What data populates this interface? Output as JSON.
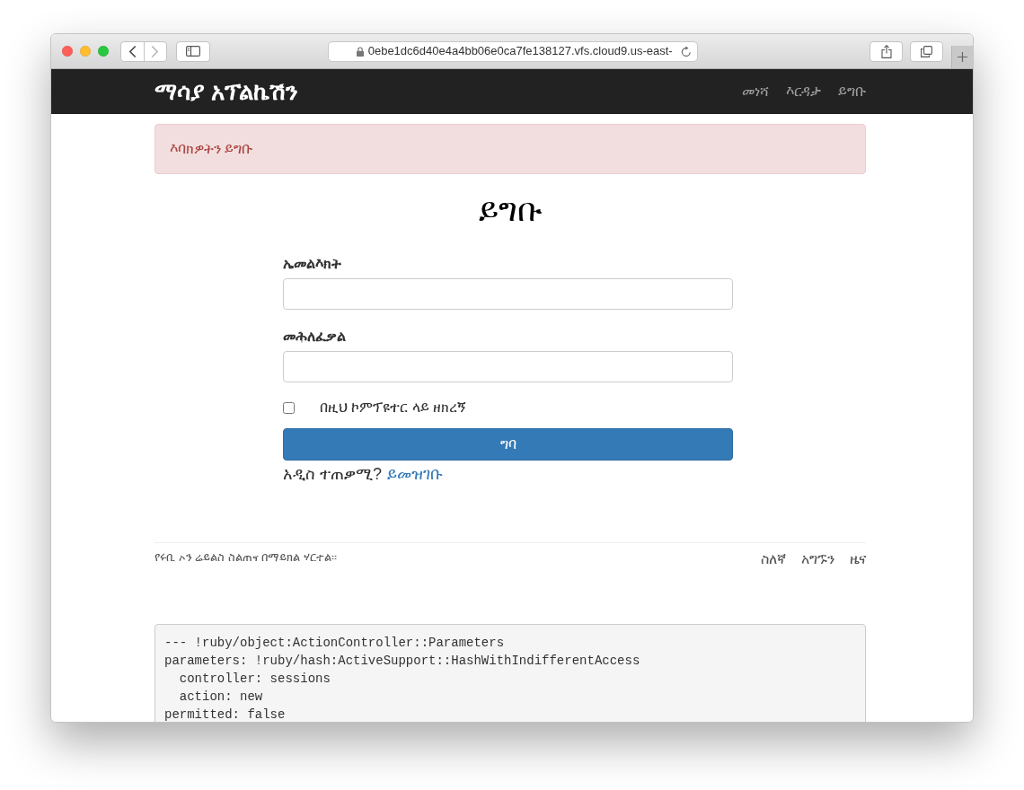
{
  "browser": {
    "nav_buttons": [
      {
        "kind": "back",
        "disabled": false
      },
      {
        "kind": "forward",
        "disabled": true
      }
    ],
    "url": "0ebe1dc6d40e4a4bb06e0ca7fe138127.vfs.cloud9.us-east-"
  },
  "navbar": {
    "brand": "ማሳያ አፕልኬሽን",
    "links": [
      "መነሻ",
      "እርዳታ",
      "ይግቡ"
    ]
  },
  "alert": {
    "kind": "danger",
    "text": "እባክዎትን ይግቡ"
  },
  "page_title": "ይግቡ",
  "form": {
    "fields": [
      {
        "label": "ኤመልእክት"
      },
      {
        "label": "መሕለፈቃል"
      }
    ],
    "remember": {
      "label": "በዚህ ኮምፕዩተር ላይ ዘክረኝ",
      "checked": false
    },
    "submit": "ግባ",
    "signup_prompt": "አዲስ ተጠቃሚ?",
    "signup_link": "ይመዝገቡ"
  },
  "footer": {
    "credit": "የሩቢ ኦን ሬይልስ ስልጠና በማይክል ሃርተል።",
    "links": [
      "ስለኛ",
      "አግኙን",
      "ዜና"
    ]
  },
  "debug": {
    "lines": [
      "--- !ruby/object:ActionController::Parameters",
      "parameters: !ruby/hash:ActiveSupport::HashWithIndifferentAccess",
      "  controller: sessions",
      "  action: new",
      "permitted: false"
    ]
  }
}
